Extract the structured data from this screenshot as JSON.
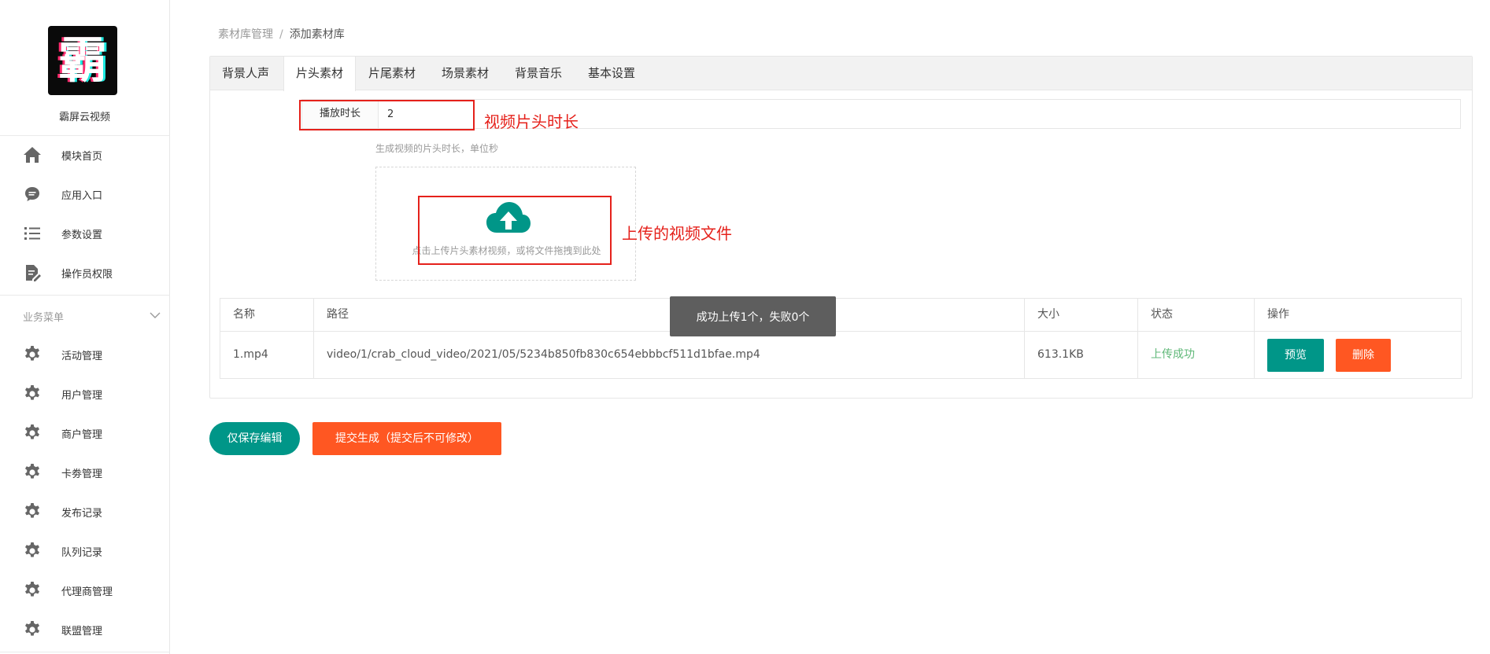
{
  "colors": {
    "primary": "#009688",
    "danger": "#ff5722",
    "success_text": "#5fb878",
    "annotation": "#e5211b"
  },
  "sidebar": {
    "logo_text": "霸",
    "app_name": "霸屏云视频",
    "top_items": [
      {
        "label": "模块首页",
        "icon": "home-icon"
      },
      {
        "label": "应用入口",
        "icon": "chat-bubble-icon"
      },
      {
        "label": "参数设置",
        "icon": "list-icon"
      },
      {
        "label": "操作员权限",
        "icon": "edit-document-icon"
      }
    ],
    "group_title": "业务菜单",
    "group_items": [
      {
        "label": "活动管理",
        "icon": "gear-icon"
      },
      {
        "label": "用户管理",
        "icon": "gear-icon"
      },
      {
        "label": "商户管理",
        "icon": "gear-icon"
      },
      {
        "label": "卡劵管理",
        "icon": "gear-icon"
      },
      {
        "label": "发布记录",
        "icon": "gear-icon"
      },
      {
        "label": "队列记录",
        "icon": "gear-icon"
      },
      {
        "label": "代理商管理",
        "icon": "gear-icon"
      },
      {
        "label": "联盟管理",
        "icon": "gear-icon"
      }
    ]
  },
  "breadcrumb": {
    "parent": "素材库管理",
    "separator": "/",
    "current": "添加素材库"
  },
  "tabs": [
    {
      "label": "背景人声",
      "active": false
    },
    {
      "label": "片头素材",
      "active": true
    },
    {
      "label": "片尾素材",
      "active": false
    },
    {
      "label": "场景素材",
      "active": false
    },
    {
      "label": "背景音乐",
      "active": false
    },
    {
      "label": "基本设置",
      "active": false
    }
  ],
  "form": {
    "duration_label": "播放时长",
    "duration_value": "2",
    "duration_help": "生成视频的片头时长，单位秒",
    "upload_text": "点击上传片头素材视频，或将文件拖拽到此处"
  },
  "annotations": {
    "duration_note": "视频片头时长",
    "upload_note": "上传的视频文件"
  },
  "table": {
    "headers": [
      "名称",
      "路径",
      "大小",
      "状态",
      "操作"
    ],
    "rows": [
      {
        "name": "1.mp4",
        "path": "video/1/crab_cloud_video/2021/05/5234b850fb830c654ebbbcf511d1bfae.mp4",
        "size": "613.1KB",
        "status": "上传成功",
        "preview_label": "预览",
        "delete_label": "删除"
      }
    ]
  },
  "toast": "成功上传1个，失败0个",
  "actions": {
    "save_label": "仅保存编辑",
    "submit_label": "提交生成（提交后不可修改）"
  }
}
